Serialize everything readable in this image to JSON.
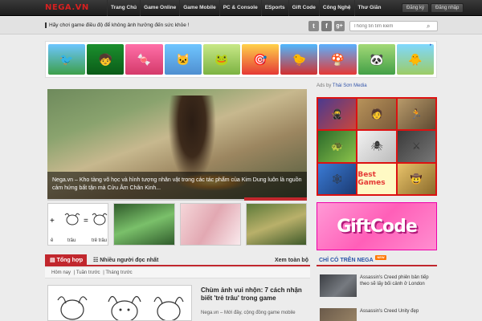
{
  "header": {
    "logo": "NEGA.VN",
    "nav": [
      "Trang Chủ",
      "Game Online",
      "Game Mobile",
      "PC & Console",
      "ESports",
      "Gift Code",
      "Công Nghệ",
      "Thư Giãn"
    ],
    "register": "Đăng ký",
    "login": "Đăng nhập"
  },
  "subbar": {
    "notice": "Hãy chơi game điều độ để không ảnh hưởng đến sức khỏe !",
    "search_placeholder": "Thông tin tìm kiếm",
    "social": [
      "twitter-icon",
      "facebook-icon",
      "google-plus-icon"
    ]
  },
  "banner": {
    "games": [
      "angry-birds",
      "ben-10",
      "candy-crush",
      "talking-tom",
      "cut-the-rope",
      "shooter",
      "angry-birds-red",
      "mario",
      "panda",
      "flappy-bird"
    ]
  },
  "slider": {
    "caption": "Nega.vn – Kho tàng võ học và hình tượng nhân vật trong các tác phẩm của Kim Dung luôn là nguồn cảm hứng bất tận mà Cửu Âm Chân Kinh..."
  },
  "thumbs": {
    "labels": [
      "ê",
      "trâu",
      "trẻ trâu"
    ]
  },
  "tabs": {
    "active": "Tổng hợp",
    "second": "Nhiều người đọc nhất",
    "all": "Xem toàn bộ",
    "sub": [
      "Hôm nay",
      "Tuần trước",
      "Tháng trước"
    ]
  },
  "article": {
    "title": "Chùm ảnh vui nhộn: 7 cách nhận biết 'trẻ trâu' trong game",
    "excerpt": "Nega.vn – Mới đây, cộng đồng game mobile"
  },
  "sidebar": {
    "ads_label": "Ads by",
    "ads_source": "Thái Sơn Media",
    "best_games": "Best Games",
    "giftcode": "GiftCode",
    "exclusive_title": "CHỈ CÓ TRÊN NEGA",
    "new_badge": "NEW",
    "items": [
      "Assassin's Creed phiên bản tiếp theo sẽ lấy bối cảnh ở London",
      "Assassin's Creed Unity đẹp"
    ]
  },
  "colors": {
    "accent": "#c1272d",
    "link": "#2a55a8",
    "topbar": "#222222"
  }
}
